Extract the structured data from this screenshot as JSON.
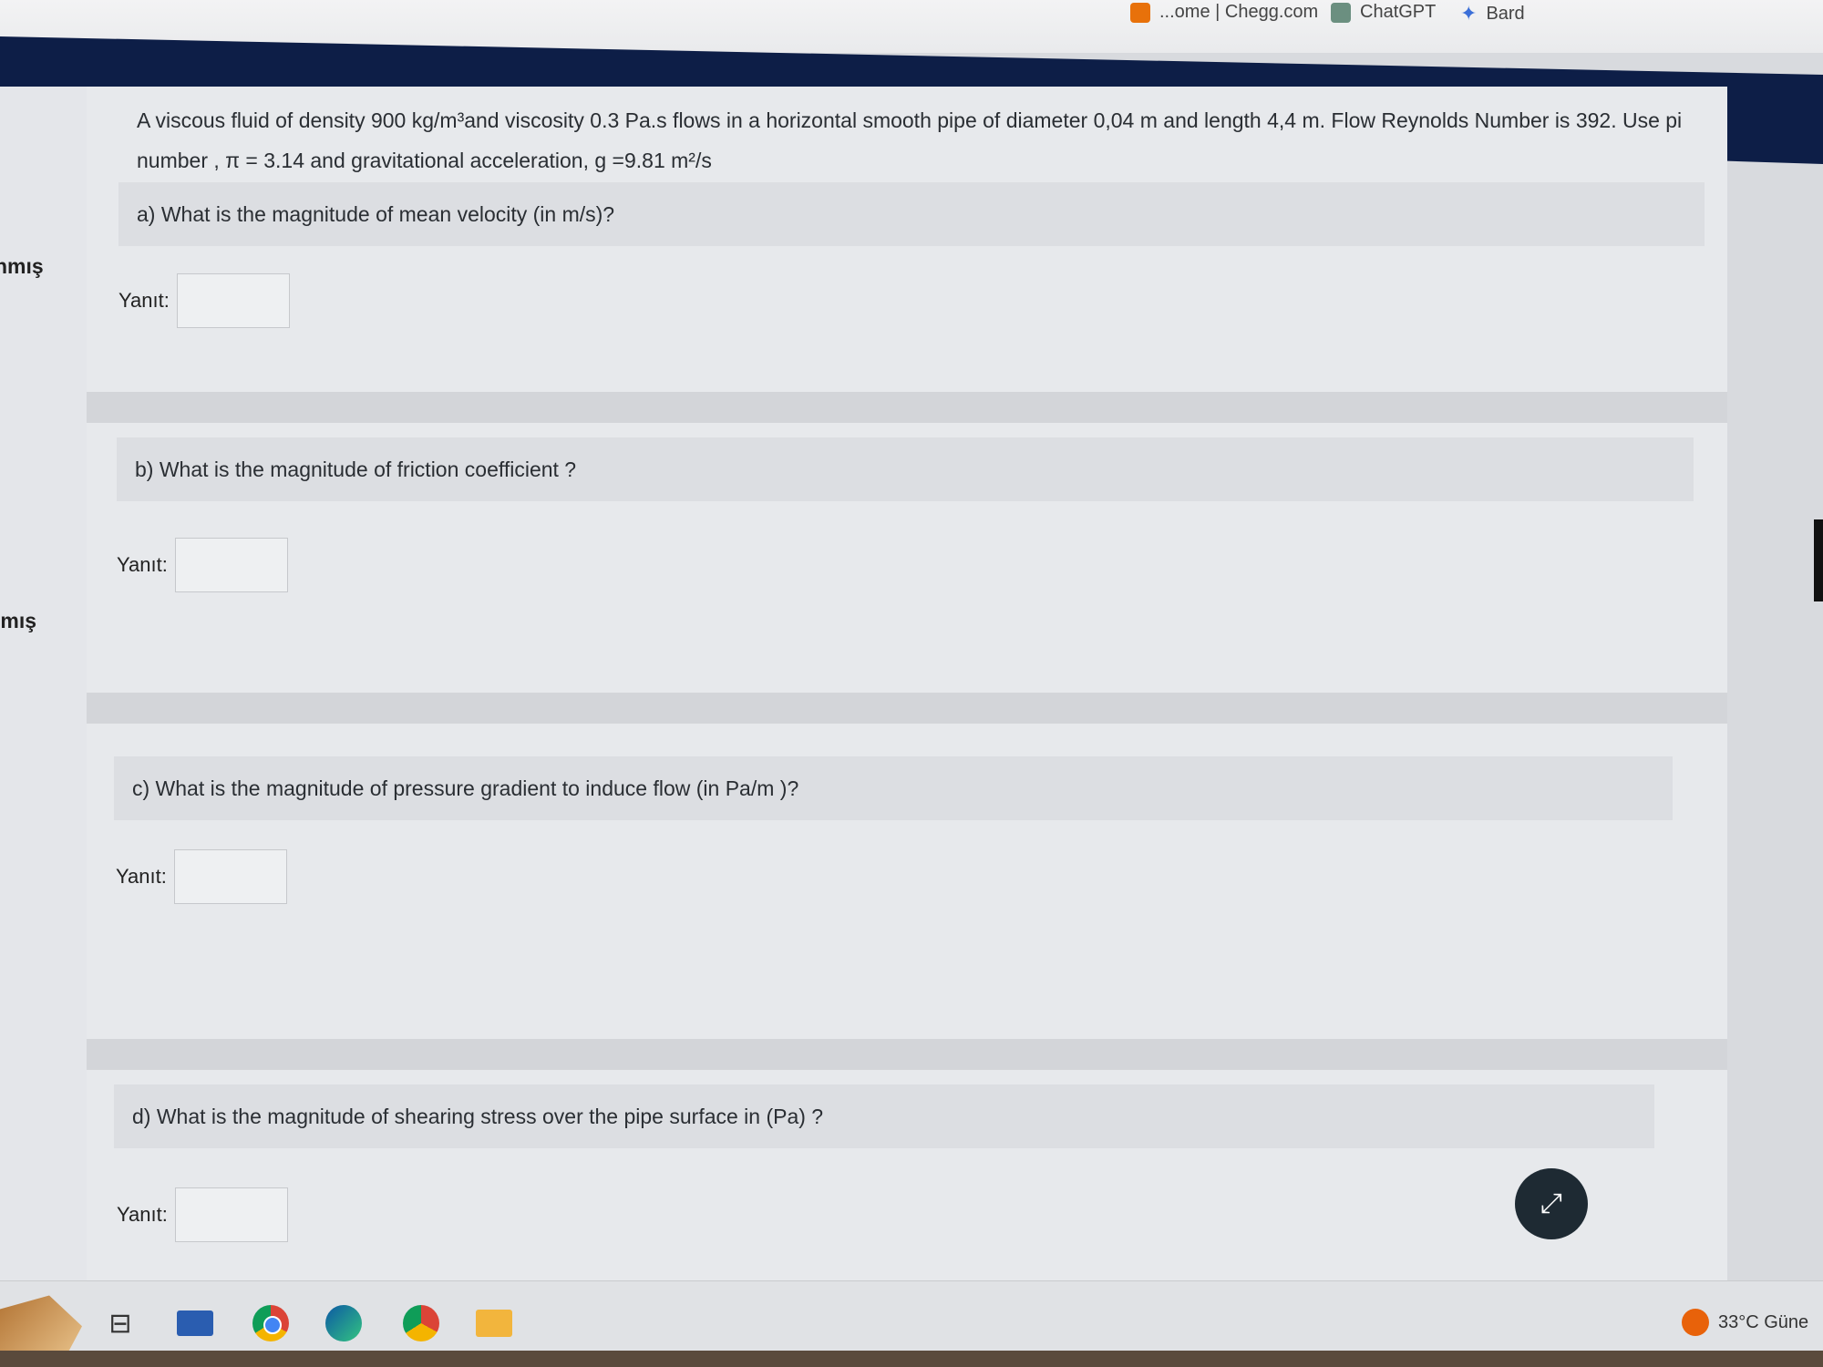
{
  "browser": {
    "bookmarks": [
      {
        "label": "...ome | Chegg.com",
        "icon": "chegg-icon"
      },
      {
        "label": "ChatGPT",
        "icon": "chatgpt-icon"
      },
      {
        "label": "Bard",
        "icon": "bard-sparkle-icon"
      }
    ]
  },
  "sidebar": {
    "fragments": [
      "nmış",
      "ımış"
    ]
  },
  "question": {
    "intro": "A viscous fluid of density 900 kg/m³and viscosity 0.3 Pa.s flows in a horizontal smooth pipe of diameter 0,04 m and length 4,4 m. Flow Reynolds Number is 392. Use pi number , π = 3.14 and gravitational acceleration, g =9.81 m²/s",
    "parts": [
      {
        "prompt": "a) What is the magnitude of mean velocity (in m/s)?",
        "answer_label": "Yanıt:",
        "value": ""
      },
      {
        "prompt": "b) What is the magnitude of friction coefficient ?",
        "answer_label": "Yanıt:",
        "value": ""
      },
      {
        "prompt": "c) What is the magnitude of pressure gradient to induce flow (in Pa/m )?",
        "answer_label": "Yanıt:",
        "value": ""
      },
      {
        "prompt": "d) What is the magnitude of shearing stress over the pipe surface in (Pa) ?",
        "answer_label": "Yanıt:",
        "value": ""
      }
    ]
  },
  "fab": {
    "icon": "expand-arrows-icon"
  },
  "taskbar": {
    "icons": [
      "widgets-icon",
      "task-view-icon",
      "remote-desktop-icon",
      "chrome-icon",
      "edge-icon",
      "chrome-profile-icon",
      "file-explorer-icon"
    ],
    "weather": "33°C Güne"
  },
  "colors": {
    "header_navy": "#0d1e47",
    "content_bg": "#e7e9ec",
    "prompt_bg": "#dcdee2"
  }
}
